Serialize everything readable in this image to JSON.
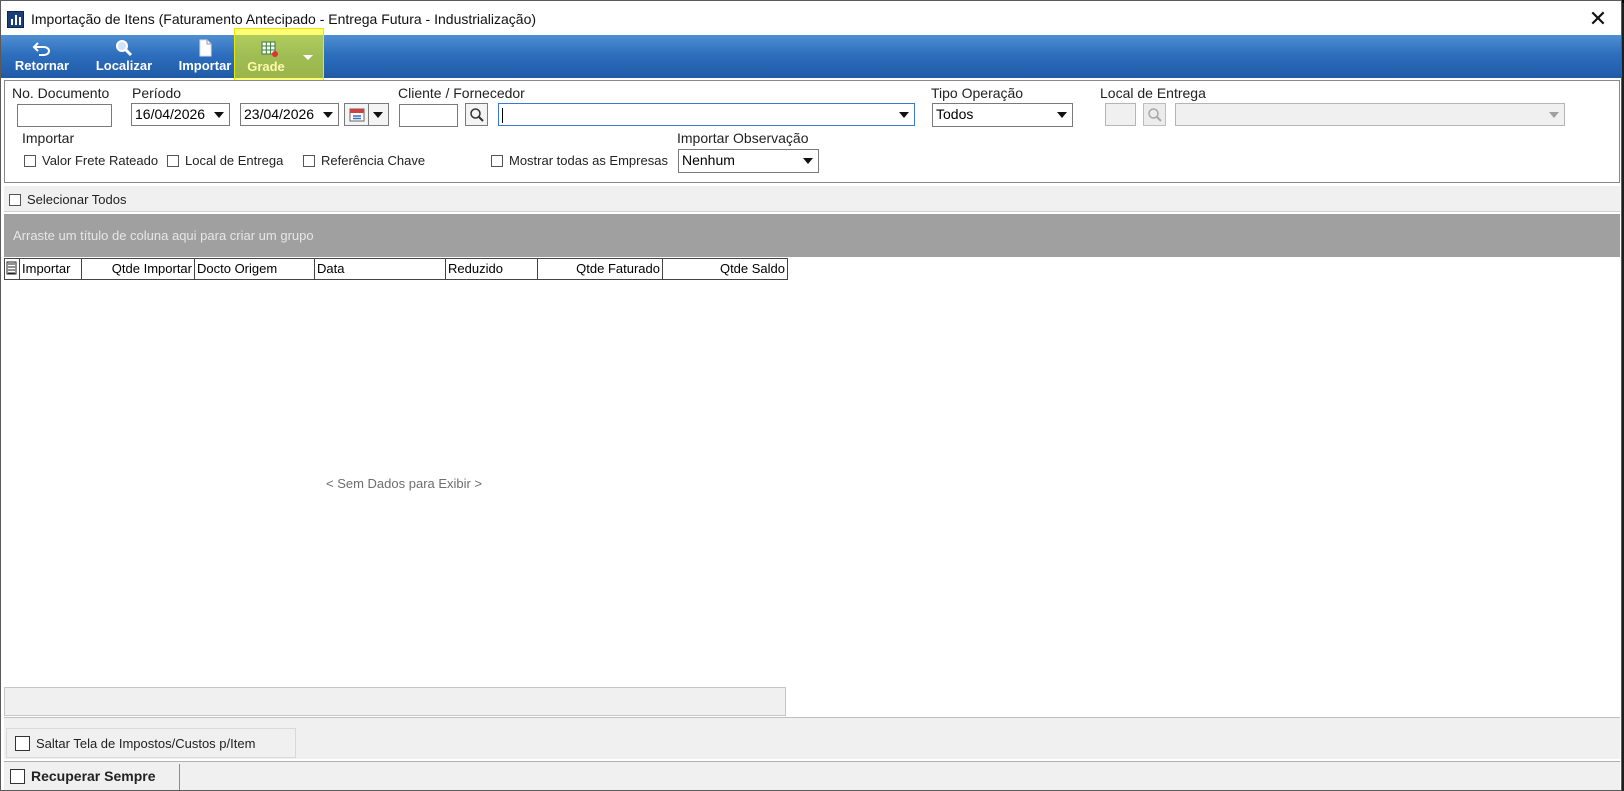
{
  "window": {
    "title": "Importação de Itens (Faturamento Antecipado - Entrega Futura - Industrialização)",
    "close_glyph": "✕"
  },
  "toolbar": {
    "retornar": "Retornar",
    "localizar": "Localizar",
    "importar": "Importar",
    "grade": "Grade",
    "highlight_color": "#ffff00",
    "bar_color": "#2e6fbd"
  },
  "filters": {
    "no_documento_label": "No. Documento",
    "no_documento_value": "",
    "periodo_label": "Período",
    "periodo_inicio": "16/04/2026",
    "periodo_fim": "23/04/2026",
    "cliente_label": "Cliente / Fornecedor",
    "cliente_codigo": "",
    "cliente_nome": "",
    "tipo_operacao_label": "Tipo Operação",
    "tipo_operacao_value": "Todos",
    "local_entrega_label": "Local de Entrega",
    "local_entrega_codigo": "",
    "local_entrega_nome": "",
    "importar_label": "Importar",
    "valor_frete_rateado": "Valor Frete Rateado",
    "local_de_entrega": "Local de Entrega",
    "referencia_chave": "Referência Chave",
    "mostrar_todas_empresas": "Mostrar todas as Empresas",
    "importar_observacao_label": "Importar Observação",
    "importar_observacao_value": "Nenhum"
  },
  "selecionar_todos": "Selecionar Todos",
  "group_panel_hint": "Arraste um título de coluna aqui para criar um grupo",
  "grid": {
    "columns": [
      "Importar",
      "Qtde Importar",
      "Docto Origem",
      "Data",
      "Reduzido",
      "Qtde Faturado",
      "Qtde Saldo"
    ],
    "empty_text": "< Sem Dados para Exibir >"
  },
  "footer": {
    "saltar_tela": "Saltar Tela de Impostos/Custos p/Item",
    "recuperar_sempre": "Recuperar Sempre"
  }
}
